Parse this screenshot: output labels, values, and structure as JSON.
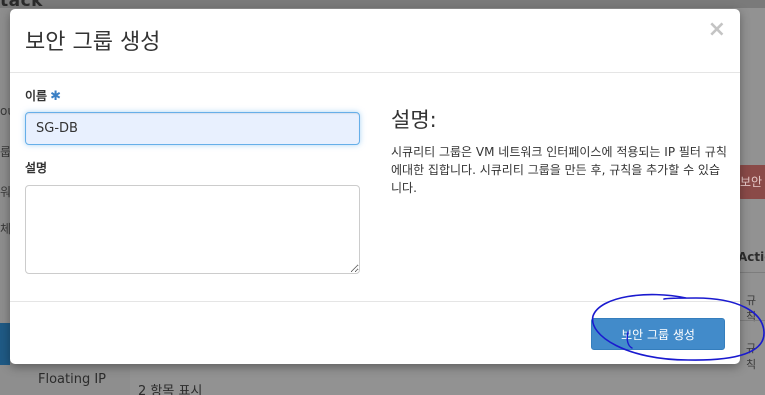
{
  "background": {
    "brand": "tack",
    "sidebar_fragments": [
      "ou",
      "룹",
      "워",
      "체"
    ],
    "sidebar_floating_ip": "Floating IP",
    "table_count": "2 항목 표시",
    "right_button_fragment": "보안",
    "action_header": "Actio",
    "row_fragment_1": "규칙",
    "row_fragment_2": "규칙"
  },
  "modal": {
    "title": "보안 그룹 생성",
    "close_glyph": "×",
    "name_field": {
      "label": "이름",
      "required_mark": "✱",
      "value": "SG-DB"
    },
    "description_field": {
      "label": "설명",
      "value": ""
    },
    "help": {
      "title": "설명:",
      "text": "시큐리티 그룹은 VM 네트워크 인터페이스에 적용되는 IP 필터 규칙에대한 집합니다. 시큐리티 그룹을 만든 후, 규칙을 추가할 수 있습니다."
    },
    "submit_label": "보안 그룹 생성"
  },
  "annotation": {
    "color": "#1a1acf"
  }
}
